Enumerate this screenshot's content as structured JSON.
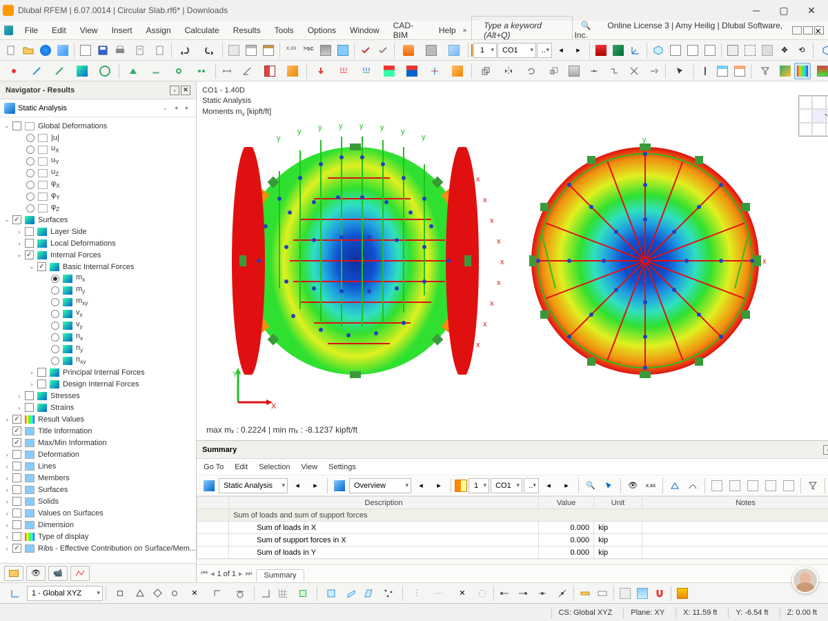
{
  "window": {
    "title": "Dlubal RFEM | 6.07.0014 | Circular Slab.rf6* | Downloads"
  },
  "menu": [
    "File",
    "Edit",
    "View",
    "Insert",
    "Assign",
    "Calculate",
    "Results",
    "Tools",
    "Options",
    "Window",
    "CAD-BIM",
    "Help"
  ],
  "keyword_placeholder": "Type a keyword (Alt+Q)",
  "license": "Online License 3 | Amy Heilig | Dlubal Software, Inc.",
  "nav": {
    "title": "Navigator - Results",
    "selector": "Static Analysis",
    "tree": {
      "global_def": "Global Deformations",
      "gd_items": [
        "|u|",
        "uX",
        "uY",
        "uZ",
        "φX",
        "φY",
        "φZ"
      ],
      "surfaces": "Surfaces",
      "layer_side": "Layer Side",
      "local_def": "Local Deformations",
      "internal_forces": "Internal Forces",
      "basic_if": "Basic Internal Forces",
      "bif_items": [
        "mx",
        "my",
        "mxy",
        "vx",
        "vy",
        "nx",
        "ny",
        "nxy"
      ],
      "pif": "Principal Internal Forces",
      "dif": "Design Internal Forces",
      "stresses": "Stresses",
      "strains": "Strains",
      "result_values": "Result Values",
      "title_info": "Title Information",
      "maxmin": "Max/Min Information",
      "deformation": "Deformation",
      "lines": "Lines",
      "members": "Members",
      "surfaces2": "Surfaces",
      "solids": "Solids",
      "vos": "Values on Surfaces",
      "dimension": "Dimension",
      "tod": "Type of display",
      "ribs": "Ribs - Effective Contribution on Surface/Mem..."
    }
  },
  "view": {
    "line1": "CO1 - 1.40D",
    "line2": "Static Analysis",
    "line3": "Moments m",
    "line3sub": "x",
    "line3unit": " [kipft/ft]",
    "foot": "max mₓ : 0.2224 | min mₓ : -8.1237 kipft/ft",
    "axis": "-Z"
  },
  "toolbar2": {
    "co_num": "1",
    "co_label": "CO1"
  },
  "summary": {
    "title": "Summary",
    "menu": [
      "Go To",
      "Edit",
      "Selection",
      "View",
      "Settings"
    ],
    "sel1": "Static Analysis",
    "sel2": "Overview",
    "co_num": "1",
    "co_label": "CO1",
    "cols": [
      "",
      "Description",
      "Value",
      "Unit",
      "Notes"
    ],
    "group": "Sum of loads and sum of support forces",
    "rows": [
      {
        "d": "Sum of loads in X",
        "v": "0.000",
        "u": "kip"
      },
      {
        "d": "Sum of support forces in X",
        "v": "0.000",
        "u": "kip"
      },
      {
        "d": "Sum of loads in Y",
        "v": "0.000",
        "u": "kip"
      }
    ],
    "page": "1 of 1",
    "tab": "Summary"
  },
  "status": {
    "cs": "CS: Global XYZ",
    "plane": "Plane: XY",
    "x": "X: 11.59 ft",
    "y": "Y: -6.54 ft",
    "z": "Z: 0.00 ft"
  },
  "bottom": {
    "coord": "1 - Global XYZ"
  }
}
